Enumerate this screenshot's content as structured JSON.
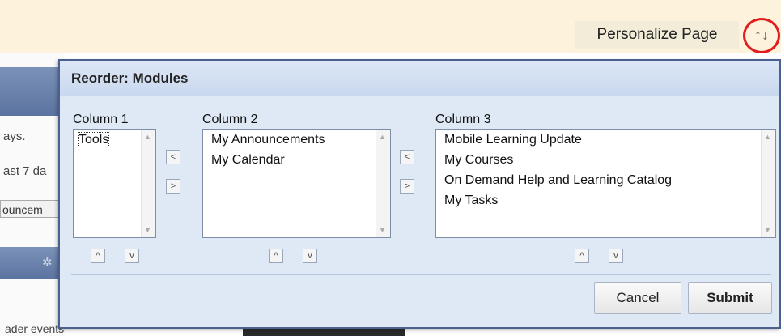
{
  "topbar": {
    "personalize_label": "Personalize Page",
    "reorder_icon": "↑↓"
  },
  "background": {
    "text1": "ays.",
    "text2": "ast 7 da",
    "button_fragment": "ouncem",
    "bottom_text": "ader events",
    "gear": "✲"
  },
  "modal": {
    "title": "Reorder: Modules",
    "columns": [
      {
        "label": "Column 1",
        "items": [
          "Tools"
        ]
      },
      {
        "label": "Column 2",
        "items": [
          "My Announcements",
          "My Calendar"
        ]
      },
      {
        "label": "Column 3",
        "items": [
          "Mobile Learning Update",
          "My Courses",
          "On Demand Help and Learning Catalog",
          "My Tasks"
        ]
      }
    ],
    "move_left": "<",
    "move_right": ">",
    "move_up": "^",
    "move_down": "v",
    "scroll_up": "▲",
    "scroll_down": "▼",
    "cancel_label": "Cancel",
    "submit_label": "Submit"
  }
}
